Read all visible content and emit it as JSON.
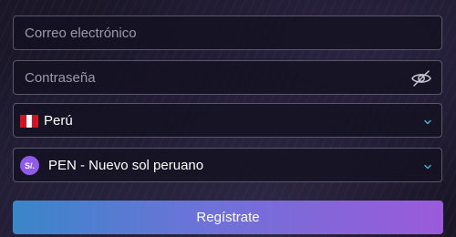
{
  "form": {
    "email": {
      "placeholder": "Correo electrónico",
      "value": ""
    },
    "password": {
      "placeholder": "Contraseña",
      "value": ""
    },
    "country": {
      "selected": "Perú",
      "flag_icon": "peru-flag-icon"
    },
    "currency": {
      "badge": "S/.",
      "selected": "PEN - Nuevo sol peruano"
    },
    "submit_label": "Regístrate"
  },
  "colors": {
    "background": "#1b1729",
    "field_border": "#5a566c",
    "accent_blue": "#3a86c9",
    "accent_purple": "#9a5ad9",
    "chevron": "#3fb6d8",
    "sol_badge": "#8f5be8"
  },
  "icons": {
    "password_toggle": "eye-slash-icon",
    "dropdown": "chevron-down-icon"
  }
}
